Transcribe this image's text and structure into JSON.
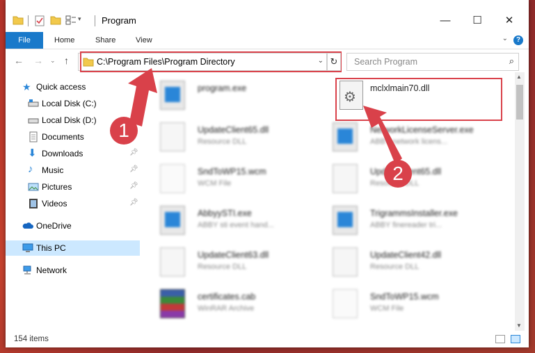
{
  "window": {
    "title": "Program",
    "controls": {
      "minimize": "—",
      "maximize": "☐",
      "close": "✕"
    }
  },
  "ribbon": {
    "tabs": [
      "File",
      "Home",
      "Share",
      "View"
    ],
    "help": "?"
  },
  "navigation": {
    "address": "C:\\Program Files\\Program Directory",
    "search_placeholder": "Search Program"
  },
  "sidebar": {
    "items": [
      {
        "label": "Quick access",
        "icon": "star-icon"
      },
      {
        "label": "Local Disk (C:)",
        "icon": "drive-icon"
      },
      {
        "label": "Local Disk (D:)",
        "icon": "drive-icon"
      },
      {
        "label": "Documents",
        "icon": "documents-icon"
      },
      {
        "label": "Downloads",
        "icon": "download-icon",
        "pinned": true
      },
      {
        "label": "Music",
        "icon": "music-icon",
        "pinned": true
      },
      {
        "label": "Pictures",
        "icon": "pictures-icon",
        "pinned": true
      },
      {
        "label": "Videos",
        "icon": "videos-icon",
        "pinned": true
      },
      {
        "label": "OneDrive",
        "icon": "cloud-icon"
      },
      {
        "label": "This PC",
        "icon": "computer-icon",
        "selected": true
      },
      {
        "label": "Network",
        "icon": "network-icon"
      }
    ]
  },
  "files": [
    {
      "name": "program.exe",
      "desc": "",
      "kind": "exe"
    },
    {
      "name": "mclxlmain70.dll",
      "desc": "",
      "kind": "dll",
      "highlighted": true
    },
    {
      "name": "UpdateClient65.dll",
      "desc": "Resource DLL",
      "kind": "dll"
    },
    {
      "name": "NetworkLicenseServer.exe",
      "desc": "ABBY network licens...",
      "kind": "exe"
    },
    {
      "name": "SndToWP15.wcm",
      "desc": "WCM File",
      "kind": "doc"
    },
    {
      "name": "UpdateClient65.dll",
      "desc": "Resource DLL",
      "kind": "dll"
    },
    {
      "name": "AbbyySTI.exe",
      "desc": "ABBY sti event hand...",
      "kind": "exe"
    },
    {
      "name": "TrigrammsInstaller.exe",
      "desc": "ABBY finereader tri...",
      "kind": "exe"
    },
    {
      "name": "UpdateClient63.dll",
      "desc": "Resource DLL",
      "kind": "dll"
    },
    {
      "name": "UpdateClient42.dll",
      "desc": "Resource DLL",
      "kind": "dll"
    },
    {
      "name": "certificates.cab",
      "desc": "WinRAR Archive",
      "kind": "rar"
    },
    {
      "name": "SndToWP15.wcm",
      "desc": "WCM File",
      "kind": "doc"
    }
  ],
  "status": {
    "count": "154 items"
  },
  "annotations": {
    "step1": "1",
    "step2": "2",
    "color": "#d9414a"
  }
}
